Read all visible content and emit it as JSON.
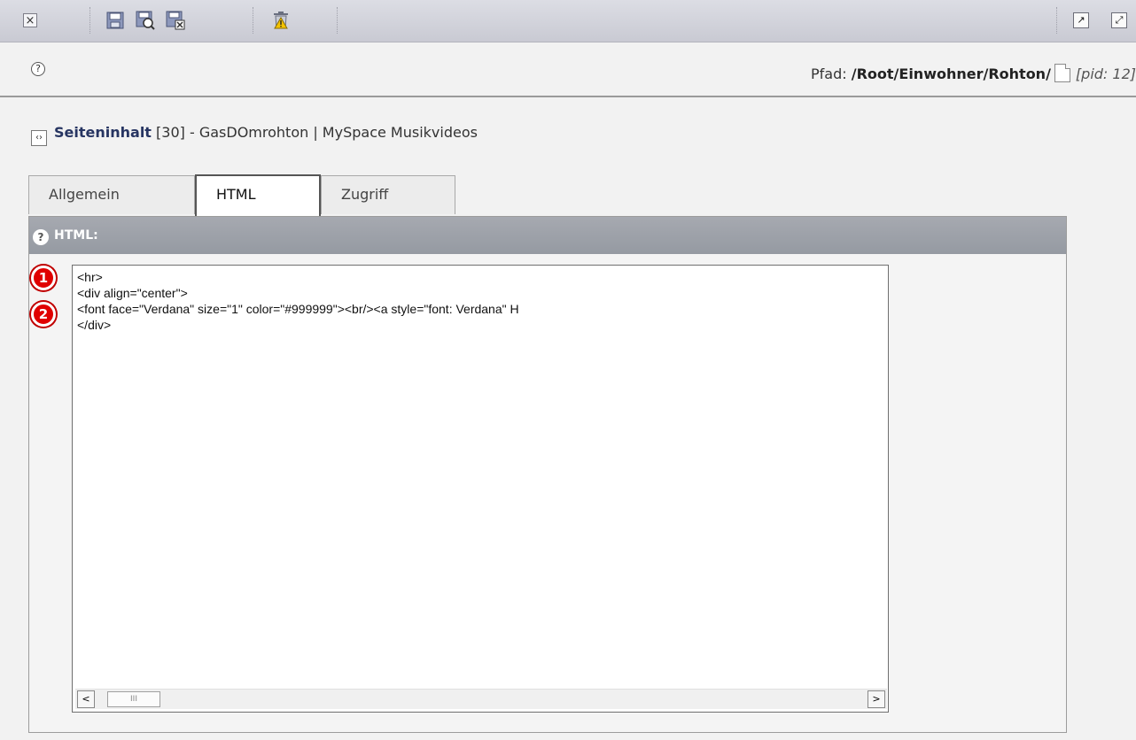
{
  "toolbar": {
    "close_glyph": "×",
    "buttons": [
      "save-icon",
      "save-and-view-icon",
      "save-and-close-icon",
      "delete-icon"
    ],
    "right_buttons": [
      "open-in-new-window-icon",
      "fullscreen-icon"
    ]
  },
  "header": {
    "help_glyph": "?",
    "path_label": "Pfad:",
    "path_value": "/Root/Einwohner/Rohton/",
    "pid_text": "[pid: 12]"
  },
  "record": {
    "type_label": "Seiteninhalt",
    "id_text": "[30]",
    "title_text": "- GasDOmrohton | MySpace Musikvideos"
  },
  "tabs": [
    {
      "label": "Allgemein",
      "active": false
    },
    {
      "label": "HTML",
      "active": true
    },
    {
      "label": "Zugriff",
      "active": false
    }
  ],
  "panel": {
    "help_glyph": "?",
    "title": "HTML:"
  },
  "editor": {
    "lines": [
      "<hr>",
      "<div align=\"center\">",
      "<font face=\"Verdana\" size=\"1\" color=\"#999999\"><br/><a style=\"font: Verdana\" H",
      "</div>"
    ],
    "scroll_left": "<",
    "scroll_right": ">",
    "thumb_grip": "III"
  },
  "markers": [
    {
      "label": "1"
    },
    {
      "label": "2"
    }
  ],
  "colors": {
    "accent": "#273562",
    "marker": "#e00000"
  }
}
